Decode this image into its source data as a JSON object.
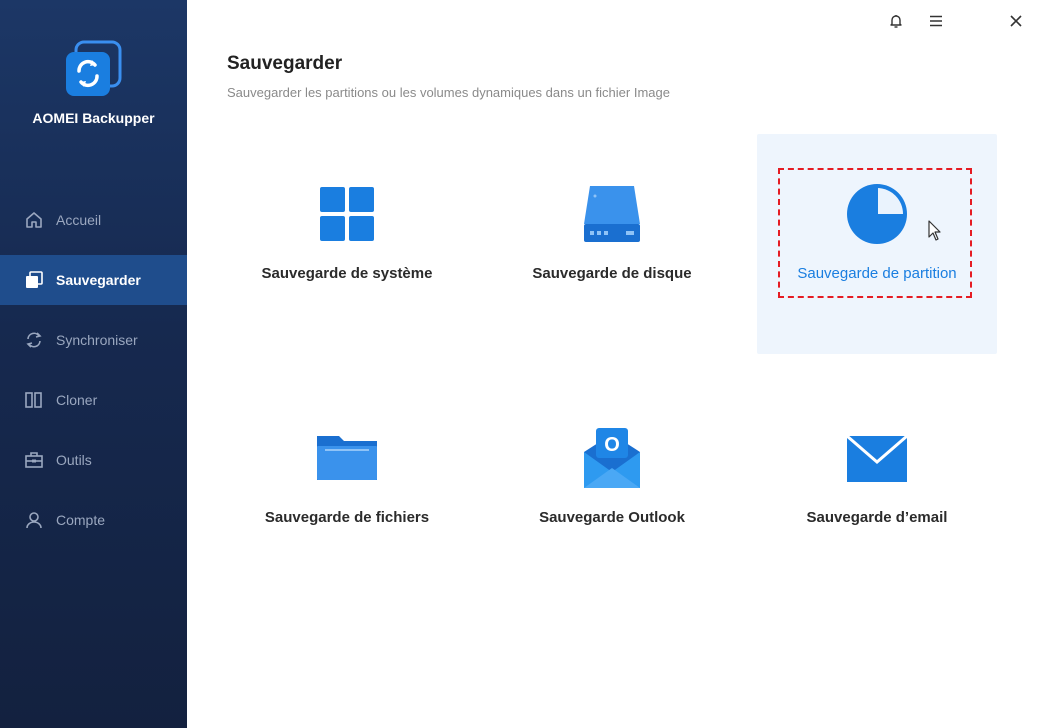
{
  "app": {
    "name": "AOMEI Backupper"
  },
  "sidebar": {
    "items": [
      {
        "label": "Accueil",
        "icon": "home-icon",
        "active": false
      },
      {
        "label": "Sauvegarder",
        "icon": "backup-icon",
        "active": true
      },
      {
        "label": "Synchroniser",
        "icon": "sync-icon",
        "active": false
      },
      {
        "label": "Cloner",
        "icon": "clone-icon",
        "active": false
      },
      {
        "label": "Outils",
        "icon": "toolbox-icon",
        "active": false
      },
      {
        "label": "Compte",
        "icon": "user-icon",
        "active": false
      }
    ]
  },
  "window_controls": [
    "bell-icon",
    "menu-icon",
    "close-icon"
  ],
  "main": {
    "title": "Sauvegarder",
    "subtitle": "Sauvegarder les partitions ou les volumes dynamiques dans un fichier Image",
    "options": [
      {
        "label": "Sauvegarde de système",
        "icon": "windows-icon",
        "selected": false
      },
      {
        "label": "Sauvegarde de disque",
        "icon": "disk-icon",
        "selected": false
      },
      {
        "label": "Sauvegarde de partition",
        "icon": "partition-pie-icon",
        "selected": true
      },
      {
        "label": "Sauvegarde de fichiers",
        "icon": "folder-icon",
        "selected": false
      },
      {
        "label": "Sauvegarde Outlook",
        "icon": "outlook-icon",
        "selected": false
      },
      {
        "label": "Sauvegarde d’email",
        "icon": "email-icon",
        "selected": false
      }
    ]
  },
  "colors": {
    "sidebar_bg": "#1c3766",
    "sidebar_active": "#1f4d8c",
    "accent": "#1a7ee0",
    "highlight_border": "#e51c23",
    "selected_card_bg": "#eef5fd"
  }
}
